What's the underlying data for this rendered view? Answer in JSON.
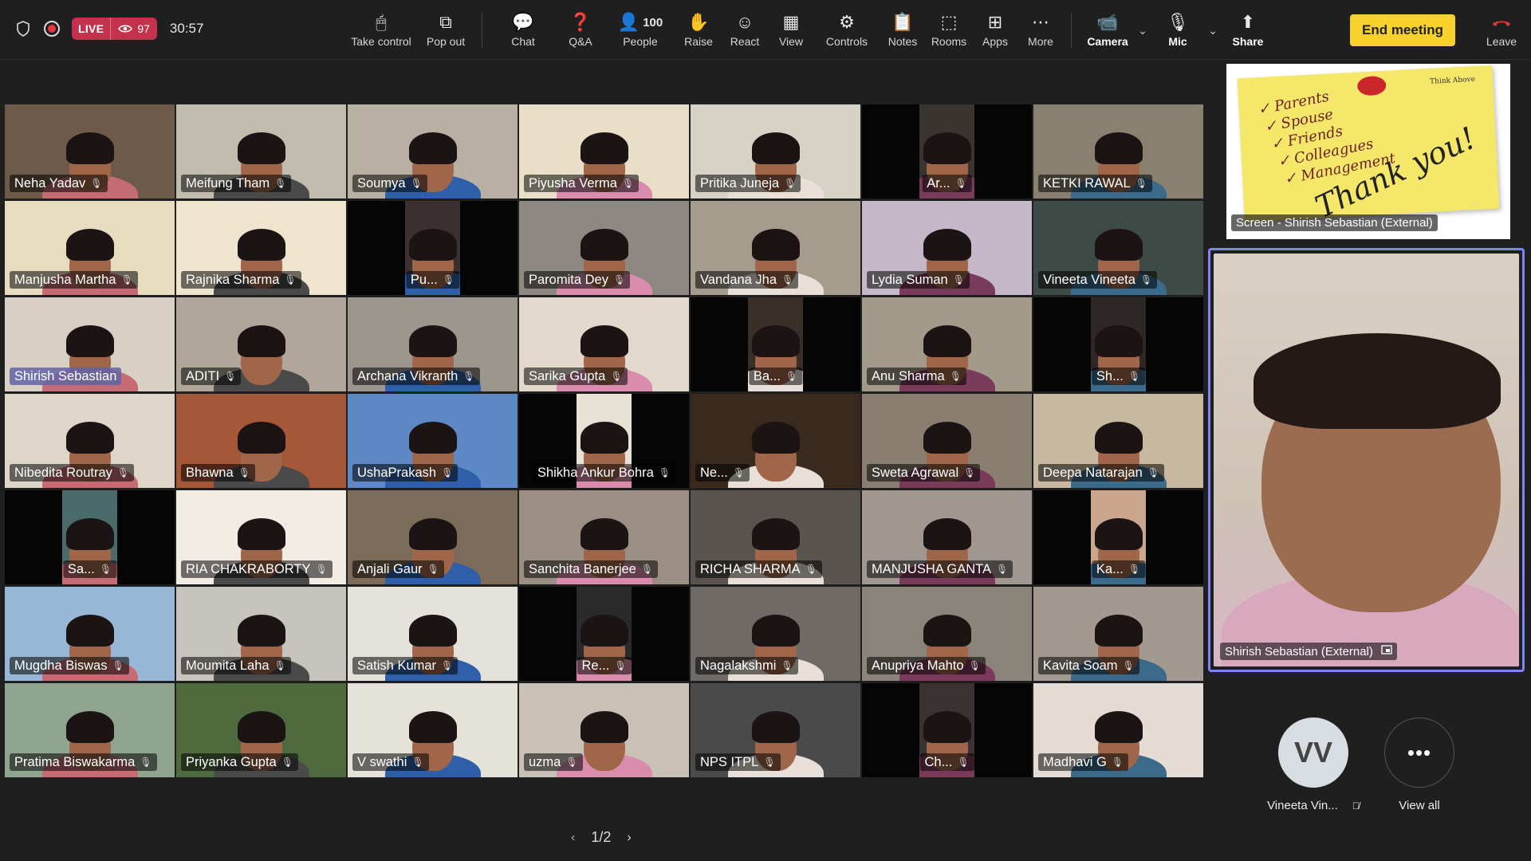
{
  "status": {
    "live_label": "LIVE",
    "viewer_count": "97",
    "timer": "30:57"
  },
  "toolbar": [
    {
      "name": "take-control",
      "label": "Take control",
      "icon": "🖱"
    },
    {
      "name": "pop-out",
      "label": "Pop out",
      "icon": "⧉"
    },
    {
      "name": "chat",
      "label": "Chat",
      "icon": "💬"
    },
    {
      "name": "qa",
      "label": "Q&A",
      "icon": "❓"
    },
    {
      "name": "people",
      "label": "People",
      "icon": "👤",
      "badge": "100"
    },
    {
      "name": "raise",
      "label": "Raise",
      "icon": "✋"
    },
    {
      "name": "react",
      "label": "React",
      "icon": "☺"
    },
    {
      "name": "view",
      "label": "View",
      "icon": "▦"
    },
    {
      "name": "controls",
      "label": "Controls",
      "icon": "⚙"
    },
    {
      "name": "notes",
      "label": "Notes",
      "icon": "📋"
    },
    {
      "name": "rooms",
      "label": "Rooms",
      "icon": "⬚"
    },
    {
      "name": "apps",
      "label": "Apps",
      "icon": "⊞"
    },
    {
      "name": "more",
      "label": "More",
      "icon": "⋯"
    }
  ],
  "devices": {
    "camera": "Camera",
    "mic": "Mic",
    "share": "Share"
  },
  "end_meeting": "End meeting",
  "leave": "Leave",
  "participants": [
    "Neha Yadav",
    "Meifung Tham",
    "Soumya",
    "Piyusha Verma",
    "Pritika Juneja",
    "Ar...",
    "KETKI RAWAL",
    "Manjusha Martha",
    "Rajnika Sharma",
    "Pu...",
    "Paromita Dey",
    "Vandana Jha",
    "Lydia Suman",
    "Vineeta Vineeta",
    "Shirish Sebastian",
    "ADITI",
    "Archana Vikranth",
    "Sarika Gupta",
    "Ba...",
    "Anu Sharma",
    "Sh...",
    "Nibedita Routray",
    "Bhawna",
    "UshaPrakash",
    "Shikha Ankur Bohra",
    "Ne...",
    "Sweta Agrawal",
    "Deepa Natarajan",
    "Sa...",
    "RIA CHAKRABORTY",
    "Anjali Gaur",
    "Sanchita Banerjee",
    "RICHA SHARMA",
    "MANJUSHA GANTA",
    "Ka...",
    "Mugdha Biswas",
    "Moumita Laha",
    "Satish Kumar",
    "Re...",
    "Nagalakshmi",
    "Anupriya Mahto",
    "Kavita Soam",
    "Pratima Biswakarma",
    "Priyanka Gupta",
    "V swathi",
    "uzma",
    "NPS ITPL",
    "Ch...",
    "Madhavi G"
  ],
  "screen_share": {
    "label": "Screen - Shirish Sebastian (External)",
    "note_items": [
      "✓ Parents",
      "✓ Spouse",
      "✓ Friends",
      "✓ Colleagues",
      "✓ Management"
    ],
    "note_signoff": "Thank you!",
    "note_tag": "Think Above"
  },
  "spotlight": {
    "label": "Shirish Sebastian (External)"
  },
  "overflow": {
    "initials": "VV",
    "name": "Vineeta Vin...",
    "view_all": "View all"
  },
  "pager": {
    "page": "1/2"
  },
  "colors": {
    "accent": "#7f85f5",
    "live": "#c4314b",
    "end": "#f8d22a",
    "leave": "#e8363a"
  }
}
